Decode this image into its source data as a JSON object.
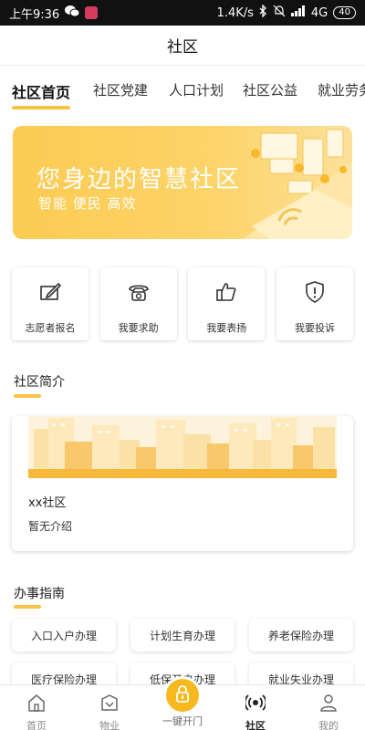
{
  "status_bar": {
    "time": "上午9:36",
    "speed": "1.4K/s",
    "network": "4G",
    "battery": "40"
  },
  "header": {
    "title": "社区"
  },
  "tabs": [
    {
      "label": "社区首页",
      "active": true
    },
    {
      "label": "社区党建"
    },
    {
      "label": "人口计划"
    },
    {
      "label": "社区公益"
    },
    {
      "label": "就业劳务"
    }
  ],
  "banner": {
    "title": "您身边的智慧社区",
    "subtitle": "智能 便民 高效"
  },
  "quick_actions": [
    {
      "label": "志愿者报名",
      "icon": "edit-icon"
    },
    {
      "label": "我要求助",
      "icon": "telephone-icon"
    },
    {
      "label": "我要表扬",
      "icon": "thumbs-up-icon"
    },
    {
      "label": "我要投诉",
      "icon": "shield-alert-icon"
    }
  ],
  "intro_section": {
    "title": "社区简介",
    "community_name": "xx社区",
    "description": "暂无介绍"
  },
  "guide_section": {
    "title": "办事指南",
    "items": [
      {
        "label": "入口入户办理"
      },
      {
        "label": "计划生育办理"
      },
      {
        "label": "养老保险办理"
      },
      {
        "label": "医疗保险办理"
      },
      {
        "label": "低保开户办理"
      },
      {
        "label": "就业失业办理"
      }
    ]
  },
  "bottom_nav": [
    {
      "label": "首页",
      "icon": "home-icon"
    },
    {
      "label": "物业",
      "icon": "property-icon"
    },
    {
      "label": "一键开门",
      "icon": "lock-icon"
    },
    {
      "label": "社区",
      "icon": "broadcast-icon",
      "active": true
    },
    {
      "label": "我的",
      "icon": "user-icon"
    }
  ],
  "colors": {
    "accent": "#f7c446",
    "accent_dark": "#f7b91e",
    "banner": "#fccb52"
  }
}
